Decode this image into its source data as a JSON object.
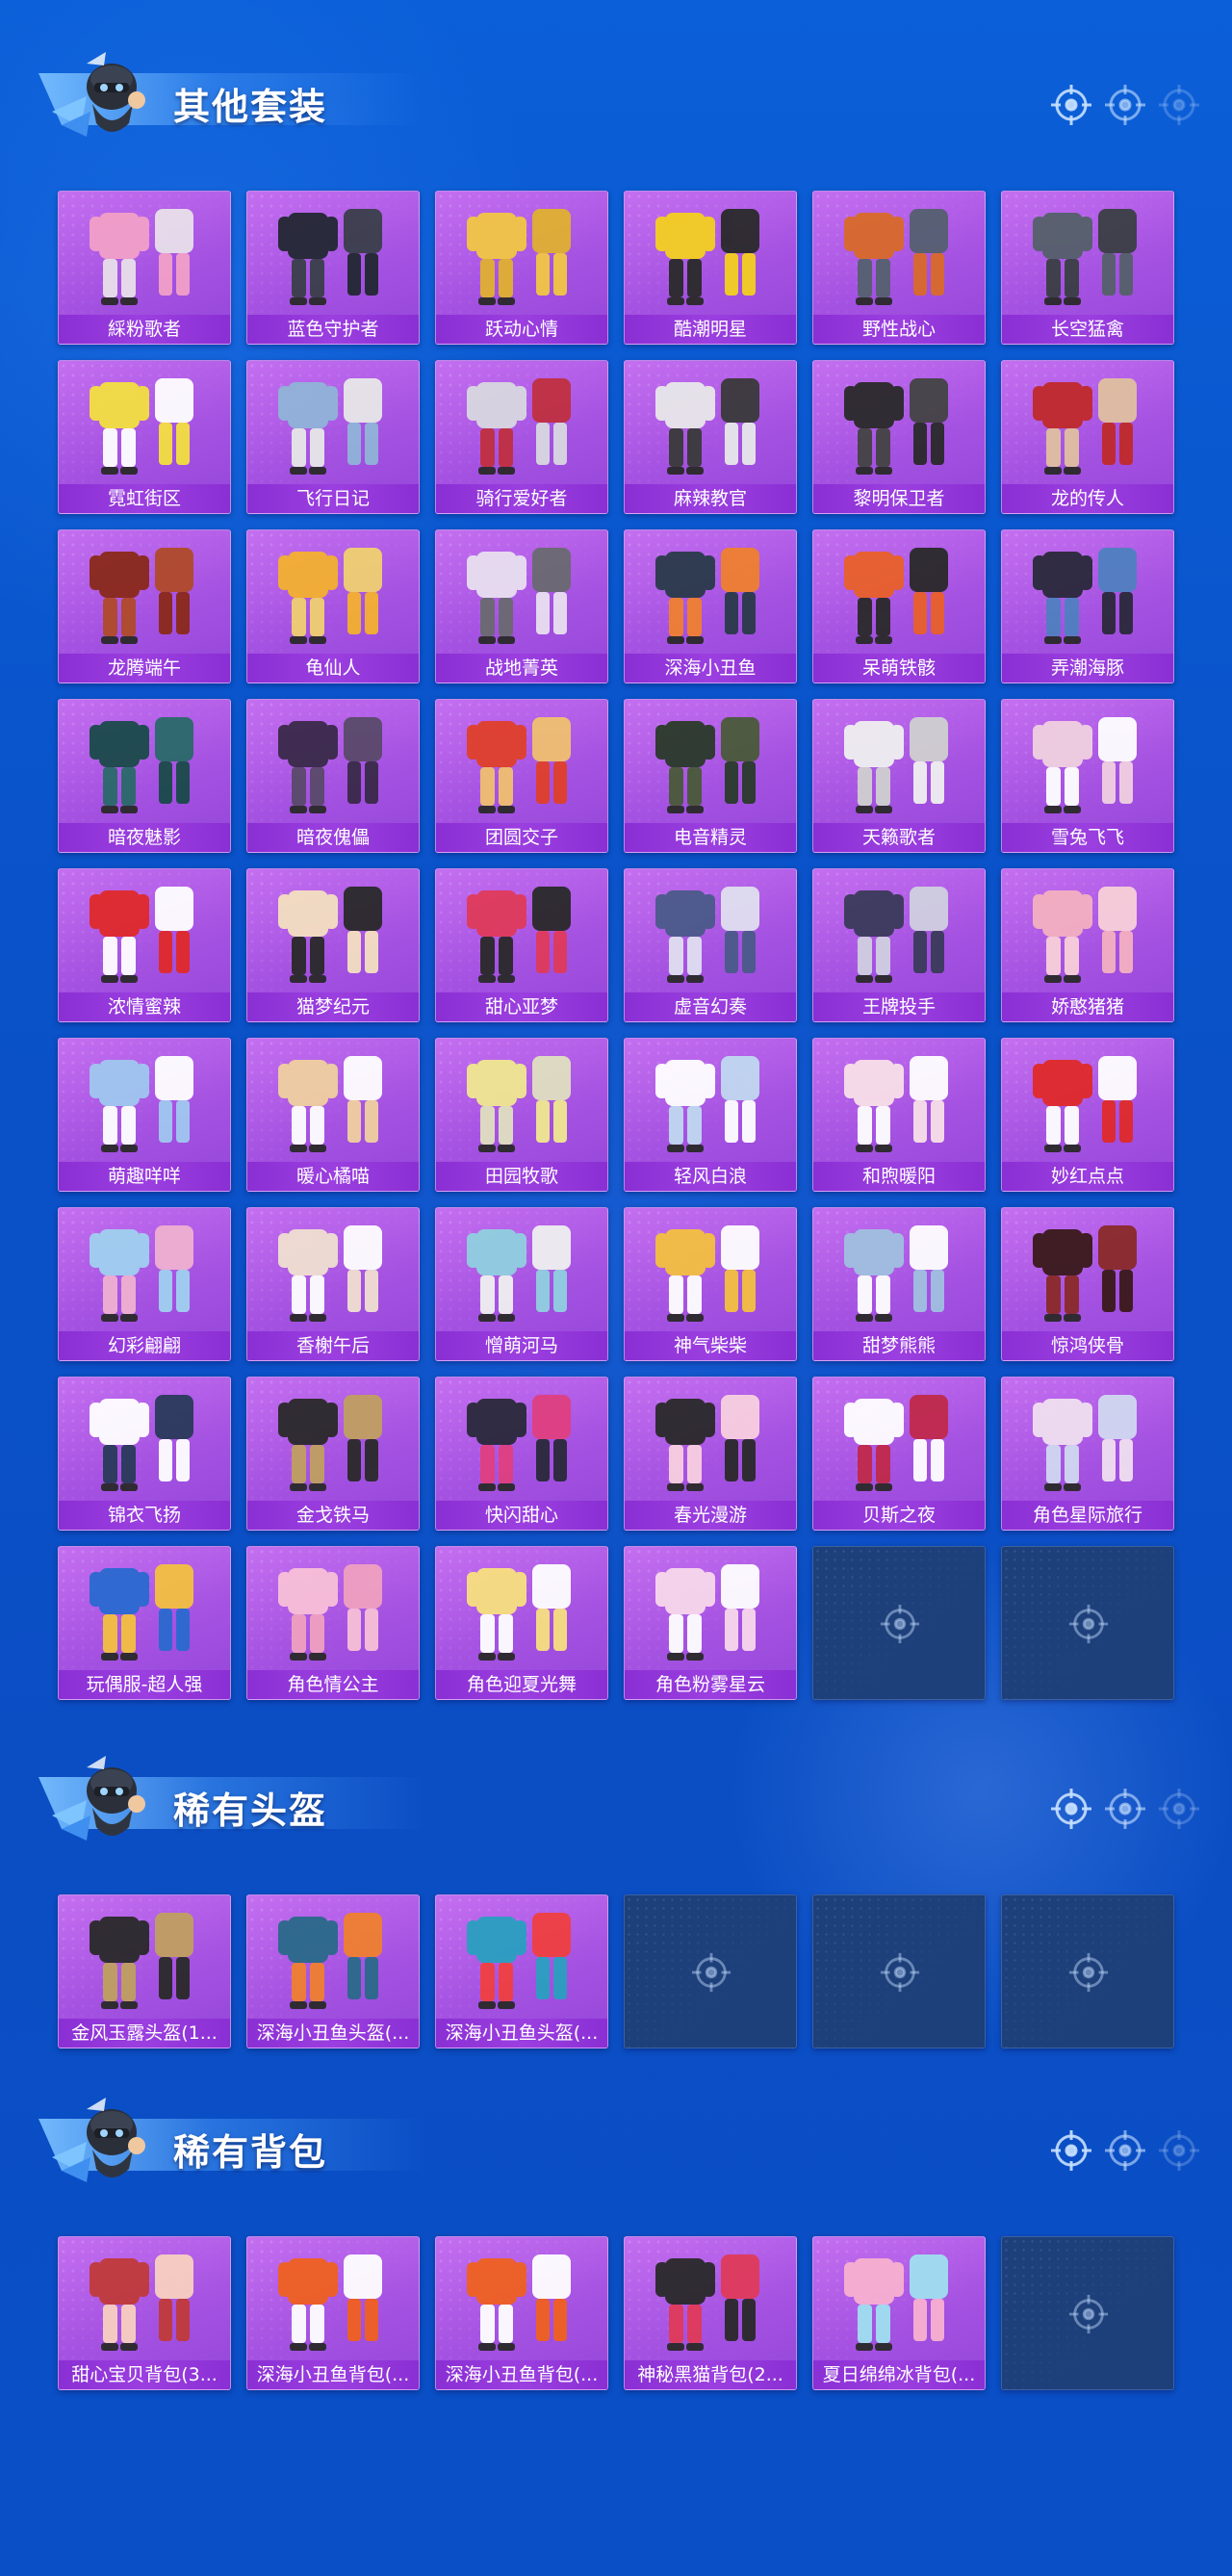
{
  "colors": {
    "background": "#0b55cc",
    "card_purple": "#a552e2",
    "card_label": "#9b3fe0",
    "empty_slot": "#1d3f7a",
    "accent_light": "#78beff"
  },
  "sections": [
    {
      "title": "其他套装",
      "icon": "soldier-mascot-icon",
      "items": [
        {
          "label": "綵粉歌者",
          "palette": [
            "#f2a0c8",
            "#e8e0ea"
          ]
        },
        {
          "label": "蓝色守护者",
          "palette": [
            "#222833",
            "#3a3f4a"
          ]
        },
        {
          "label": "跃动心情",
          "palette": [
            "#f2c744",
            "#e0b030"
          ]
        },
        {
          "label": "酷潮明星",
          "palette": [
            "#f4d020",
            "#2a2a2a"
          ]
        },
        {
          "label": "野性战心",
          "palette": [
            "#d96a2a",
            "#556070"
          ]
        },
        {
          "label": "长空猛禽",
          "palette": [
            "#55606a",
            "#3a3f44"
          ]
        },
        {
          "label": "霓虹街区",
          "palette": [
            "#f4e040",
            "#ffffff"
          ]
        },
        {
          "label": "飞行日记",
          "palette": [
            "#90b4d8",
            "#e8e8e8"
          ]
        },
        {
          "label": "骑行爱好者",
          "palette": [
            "#d8d8e0",
            "#c03040"
          ]
        },
        {
          "label": "麻辣教官",
          "palette": [
            "#e8e8ea",
            "#3a3a3a"
          ]
        },
        {
          "label": "黎明保卫者",
          "palette": [
            "#2a2a2a",
            "#444444"
          ]
        },
        {
          "label": "龙的传人",
          "palette": [
            "#c02a2a",
            "#e0c0a0"
          ]
        },
        {
          "label": "龙腾端午",
          "palette": [
            "#8a2a1a",
            "#b04a2a"
          ]
        },
        {
          "label": "龟仙人",
          "palette": [
            "#f4b030",
            "#f0d070"
          ]
        },
        {
          "label": "战地菁英",
          "palette": [
            "#e8e0f0",
            "#6a6a70"
          ]
        },
        {
          "label": "深海小丑鱼",
          "palette": [
            "#2a3a4a",
            "#f08030"
          ]
        },
        {
          "label": "呆萌铁骸",
          "palette": [
            "#e8602a",
            "#2a2a2a"
          ]
        },
        {
          "label": "弄潮海豚",
          "palette": [
            "#2a2a3a",
            "#5080c0"
          ]
        },
        {
          "label": "暗夜魅影",
          "palette": [
            "#1a4a4a",
            "#2a6a6a"
          ]
        },
        {
          "label": "暗夜傀儡",
          "palette": [
            "#3a2a4a",
            "#5a4a6a"
          ]
        },
        {
          "label": "团圆交子",
          "palette": [
            "#e0402a",
            "#f0c070"
          ]
        },
        {
          "label": "电音精灵",
          "palette": [
            "#2a3a2a",
            "#4a5a3a"
          ]
        },
        {
          "label": "天籁歌者",
          "palette": [
            "#f0f0f0",
            "#d0d0d0"
          ]
        },
        {
          "label": "雪兔飞飞",
          "palette": [
            "#f0d0e0",
            "#ffffff"
          ]
        },
        {
          "label": "浓情蜜辣",
          "palette": [
            "#e02a2a",
            "#ffffff"
          ]
        },
        {
          "label": "猫梦纪元",
          "palette": [
            "#f4e0c0",
            "#2a2a2a"
          ]
        },
        {
          "label": "甜心亚梦",
          "palette": [
            "#e03a5a",
            "#2a2a2a"
          ]
        },
        {
          "label": "虚音幻奏",
          "palette": [
            "#4a5a8a",
            "#e0e0f0"
          ]
        },
        {
          "label": "王牌投手",
          "palette": [
            "#3a3a5a",
            "#d0d0e0"
          ]
        },
        {
          "label": "娇憨猪猪",
          "palette": [
            "#f4b0c0",
            "#f8d0d8"
          ]
        },
        {
          "label": "萌趣咩咩",
          "palette": [
            "#a0c8f0",
            "#ffffff"
          ]
        },
        {
          "label": "暖心橘喵",
          "palette": [
            "#f0d0a0",
            "#ffffff"
          ]
        },
        {
          "label": "田园牧歌",
          "palette": [
            "#f0e890",
            "#e0e0c0"
          ]
        },
        {
          "label": "轻风白浪",
          "palette": [
            "#ffffff",
            "#c0d8f0"
          ]
        },
        {
          "label": "和煦暖阳",
          "palette": [
            "#f8e0e8",
            "#ffffff"
          ]
        },
        {
          "label": "妙红点点",
          "palette": [
            "#e02a2a",
            "#ffffff"
          ]
        },
        {
          "label": "幻彩翩翩",
          "palette": [
            "#a0d0f0",
            "#f0b0d0"
          ]
        },
        {
          "label": "香榭午后",
          "palette": [
            "#f0e0d0",
            "#ffffff"
          ]
        },
        {
          "label": "憎萌河马",
          "palette": [
            "#90d0e0",
            "#f0f0f0"
          ]
        },
        {
          "label": "神气柴柴",
          "palette": [
            "#f4c040",
            "#ffffff"
          ]
        },
        {
          "label": "甜梦熊熊",
          "palette": [
            "#a0c0e0",
            "#ffffff"
          ]
        },
        {
          "label": "惊鸿侠骨",
          "palette": [
            "#3a1a1a",
            "#8a2a2a"
          ]
        },
        {
          "label": "锦衣飞扬",
          "palette": [
            "#ffffff",
            "#2a3a5a"
          ]
        },
        {
          "label": "金戈铁马",
          "palette": [
            "#2a2a2a",
            "#c0a060"
          ]
        },
        {
          "label": "快闪甜心",
          "palette": [
            "#2a2a3a",
            "#e04080"
          ]
        },
        {
          "label": "春光漫游",
          "palette": [
            "#2a2a2a",
            "#f8d0e0"
          ]
        },
        {
          "label": "贝斯之夜",
          "palette": [
            "#ffffff",
            "#c02a4a"
          ]
        },
        {
          "label": "角色星际旅行",
          "palette": [
            "#f0e0f0",
            "#d0d8f0"
          ]
        },
        {
          "label": "玩偶服-超人强",
          "palette": [
            "#2a6ad0",
            "#f4c040"
          ]
        },
        {
          "label": "角色情公主",
          "palette": [
            "#f8c0d8",
            "#f0a0c0"
          ]
        },
        {
          "label": "角色迎夏光舞",
          "palette": [
            "#f8e080",
            "#ffffff"
          ]
        },
        {
          "label": "角色粉雾星云",
          "palette": [
            "#f8d8ec",
            "#ffffff"
          ]
        }
      ],
      "empty_slots": 2
    },
    {
      "title": "稀有头盔",
      "icon": "soldier-mascot-icon",
      "items": [
        {
          "label": "金风玉露头盔(1...",
          "palette": [
            "#2a2a2a",
            "#c0a060"
          ]
        },
        {
          "label": "深海小丑鱼头盔(...",
          "palette": [
            "#2a6a8a",
            "#f08030"
          ]
        },
        {
          "label": "深海小丑鱼头盔(...",
          "palette": [
            "#2aa0c0",
            "#f04040"
          ]
        }
      ],
      "empty_slots": 3
    },
    {
      "title": "稀有背包",
      "icon": "soldier-mascot-icon",
      "items": [
        {
          "label": "甜心宝贝背包(3...",
          "palette": [
            "#c03a3a",
            "#f8d0c0"
          ]
        },
        {
          "label": "深海小丑鱼背包(...",
          "palette": [
            "#f06020",
            "#ffffff"
          ]
        },
        {
          "label": "深海小丑鱼背包(...",
          "palette": [
            "#f06020",
            "#ffffff"
          ]
        },
        {
          "label": "神秘黑猫背包(2...",
          "palette": [
            "#2a2a2a",
            "#e03a5a"
          ]
        },
        {
          "label": "夏日绵绵冰背包(...",
          "palette": [
            "#f8b0d0",
            "#a0e0f0"
          ]
        }
      ],
      "empty_slots": 1
    }
  ]
}
